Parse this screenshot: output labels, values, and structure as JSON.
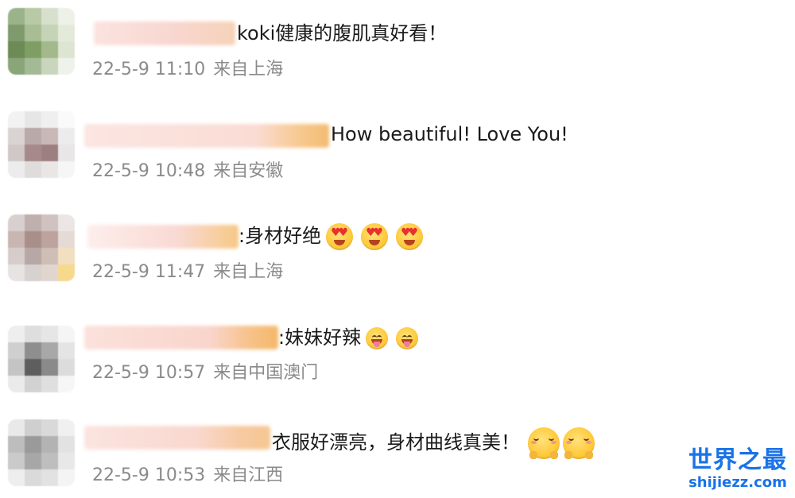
{
  "comments": [
    {
      "text": "koki健康的腹肌真好看！",
      "time": "22-5-9 11:10",
      "location": "来自上海",
      "emojis": []
    },
    {
      "text": "How beautiful! Love You!",
      "time": "22-5-9 10:48",
      "location": "来自安徽",
      "emojis": []
    },
    {
      "text": ":身材好绝",
      "time": "22-5-9 11:47",
      "location": "来自上海",
      "emojis": [
        "heart-eyes-emoji",
        "heart-eyes-emoji",
        "heart-eyes-emoji"
      ]
    },
    {
      "text": ":妹妹好辣",
      "time": "22-5-9 10:57",
      "location": "来自中国澳门",
      "emojis": [
        "tongue-out-emoji",
        "tongue-out-emoji"
      ]
    },
    {
      "text": "衣服好漂亮，身材曲线真美！",
      "time": "22-5-9 10:53",
      "location": "来自江西",
      "emojis": [
        "blushing-hands-emoji",
        "blushing-hands-emoji"
      ]
    }
  ],
  "watermark": {
    "title": "世界之最",
    "url": "shijiezz.com",
    "color": "#1a73e8"
  }
}
